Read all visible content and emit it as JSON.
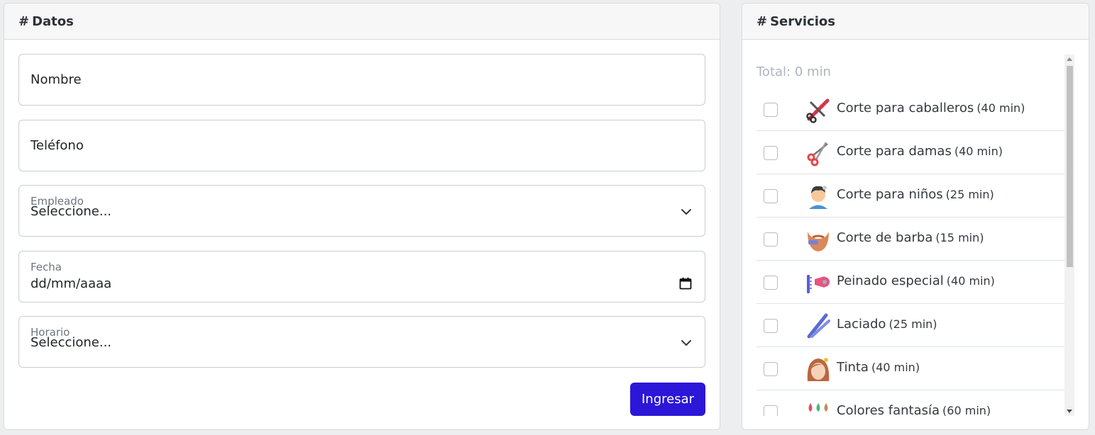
{
  "datos": {
    "title": "Datos",
    "hash": "#",
    "nombre_placeholder": "Nombre",
    "telefono_placeholder": "Teléfono",
    "empleado_label": "Empleado",
    "empleado_value": "Seleccione...",
    "fecha_label": "Fecha",
    "fecha_value": "dd/mm/aaaa",
    "horario_label": "Horario",
    "horario_value": "Seleccione...",
    "submit_label": "Ingresar"
  },
  "servicios": {
    "title": "Servicios",
    "hash": "#",
    "total": "Total: 0 min",
    "items": [
      {
        "label": "Corte para caballeros",
        "duration": "(40 min)",
        "icon": "comb-scissors-icon",
        "checked": false
      },
      {
        "label": "Corte para damas",
        "duration": "(40 min)",
        "icon": "scissors-icon",
        "checked": false
      },
      {
        "label": "Corte para niños",
        "duration": "(25 min)",
        "icon": "child-haircut-icon",
        "checked": false
      },
      {
        "label": "Corte de barba",
        "duration": "(15 min)",
        "icon": "beard-icon",
        "checked": false
      },
      {
        "label": "Peinado especial",
        "duration": "(40 min)",
        "icon": "hair-dryer-icon",
        "checked": false
      },
      {
        "label": "Laciado",
        "duration": "(25 min)",
        "icon": "hair-straightener-icon",
        "checked": false
      },
      {
        "label": "Tinta",
        "duration": "(40 min)",
        "icon": "hair-dye-icon",
        "checked": false
      },
      {
        "label": "Colores fantasía",
        "duration": "(60 min)",
        "icon": "color-drops-icon",
        "checked": false
      }
    ]
  },
  "colors": {
    "primary_button": "#2c16d8",
    "page_background": "#eceef0"
  }
}
